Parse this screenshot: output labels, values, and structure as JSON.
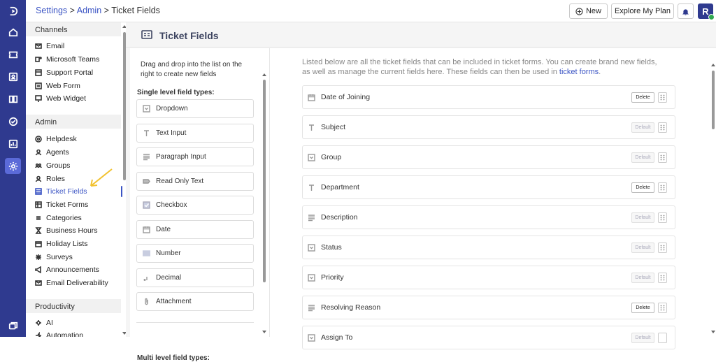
{
  "breadcrumb": {
    "settings": "Settings",
    "sep1": " > ",
    "admin": "Admin",
    "sep2": " > ",
    "current": "Ticket Fields"
  },
  "topbar": {
    "new_label": "New",
    "plan_label": "Explore My Plan",
    "avatar_initial": "R"
  },
  "rail": {
    "icons": [
      "logo-icon",
      "home-icon",
      "tickets-icon",
      "contacts-icon",
      "knowledge-base-icon",
      "tasks-icon",
      "reports-icon",
      "settings-icon",
      "chat-icon"
    ]
  },
  "sidebar": {
    "channels_title": "Channels",
    "channels": [
      "Email",
      "Microsoft Teams",
      "Support Portal",
      "Web Form",
      "Web Widget"
    ],
    "admin_title": "Admin",
    "admin": [
      "Helpdesk",
      "Agents",
      "Groups",
      "Roles",
      "Ticket Fields",
      "Ticket Forms",
      "Categories",
      "Business Hours",
      "Holiday Lists",
      "Surveys",
      "Announcements",
      "Email Deliverability"
    ],
    "productivity_title": "Productivity",
    "productivity": [
      "AI",
      "Automation"
    ]
  },
  "page": {
    "title": "Ticket Fields"
  },
  "palette": {
    "hint": "Drag and drop into the list on the right to create new fields",
    "single_title": "Single level field types:",
    "single_types": [
      "Dropdown",
      "Text Input",
      "Paragraph Input",
      "Read Only Text",
      "Checkbox",
      "Date",
      "Number",
      "Decimal",
      "Attachment"
    ],
    "multi_title": "Multi level field types:"
  },
  "main": {
    "desc_text": "Listed below are all the ticket fields that can be included in ticket forms. You can create brand new fields, as well as manage the current fields here. These fields can then be used in ",
    "desc_link": "ticket forms",
    "desc_end": ".",
    "fields": [
      {
        "label": "Date of Joining",
        "action": "Delete"
      },
      {
        "label": "Subject",
        "action": "Default"
      },
      {
        "label": "Group",
        "action": "Default"
      },
      {
        "label": "Department",
        "action": "Delete"
      },
      {
        "label": "Description",
        "action": "Default"
      },
      {
        "label": "Status",
        "action": "Default"
      },
      {
        "label": "Priority",
        "action": "Default"
      },
      {
        "label": "Resolving Reason",
        "action": "Delete"
      },
      {
        "label": "Assign To",
        "action": "Default"
      }
    ]
  },
  "colors": {
    "rail": "#2f3a8f",
    "accent": "#3b54c4",
    "arrow": "#f2c230"
  }
}
